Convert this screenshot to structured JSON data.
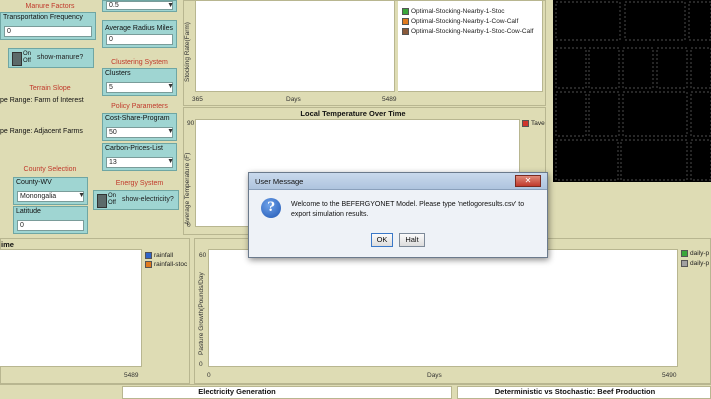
{
  "left_panel": {
    "manure_factors_label": "Manure Factors",
    "transport_label": "Transportation Frequency",
    "transport_value": "0",
    "show_manure_label": "show-manure?",
    "on": "On",
    "off": "Off",
    "terrain_slope_label": "Terrain Slope",
    "slope_farm": "pe Range: Farm of Interest",
    "slope_adjacent": "pe Range: Adjacent Farms",
    "county_selection_label": "County Selection",
    "county_wv_label": "County-WV",
    "county_wv_value": "Monongalia",
    "latitude_label": "Latitude",
    "latitude_value": "0"
  },
  "mid_panel": {
    "top_value": "0.5",
    "avg_radius_label": "Average Radius Miles",
    "avg_radius_value": "0",
    "clustering_label": "Clustering System",
    "clusters_label": "Clusters",
    "clusters_value": "5",
    "policy_label": "Policy Parameters",
    "cost_share_label": "Cost-Share-Program",
    "cost_share_value": "50",
    "carbon_label": "Carbon-Prices-List",
    "carbon_value": "13",
    "energy_label": "Energy System",
    "show_electricity_label": "show-electricity?"
  },
  "stocking_plot": {
    "ylabel": "Stocking Rate(Farm)",
    "x_min": "365",
    "x_mid": "Days",
    "x_max": "5489",
    "legend": [
      {
        "label": "Optimal-Stocking-Nearby-1-Stoc",
        "color": "#3aa63a"
      },
      {
        "label": "Optimal-Stocking-Nearby-1-Cow-Calf",
        "color": "#e07a1e"
      },
      {
        "label": "Optimal-Stocking-Nearby-1-Stoc-Cow-Calf",
        "color": "#8a5a3a"
      }
    ]
  },
  "temp_plot": {
    "title": "Local Temperature Over Time",
    "ylabel": "Average Temperature (F)",
    "y_top": "90",
    "y_bottom": "0",
    "legend_label": "Tave",
    "legend_color": "#d0342c"
  },
  "rain_plot": {
    "title_fragment": "ime",
    "x_max": "5489",
    "legend": [
      {
        "label": "rainfall",
        "color": "#2f64c8"
      },
      {
        "label": "rainfall-stoc",
        "color": "#e07a1e"
      }
    ]
  },
  "pasture_plot": {
    "ylabel": "Pasture Growth(Pounds/Day",
    "y_top": "60",
    "y_bottom": "0",
    "x_min": "0",
    "x_mid": "Days",
    "x_max": "5490",
    "legend": [
      {
        "label": "daily-p",
        "color": "#3aa63a"
      },
      {
        "label": "daily-p",
        "color": "#a0a0a0"
      }
    ]
  },
  "bottom": {
    "electricity_title": "Electricity Generation",
    "beef_title": "Deterministic vs Stochastic: Beef Production"
  },
  "dialog": {
    "title": "User Message",
    "close_glyph": "✕",
    "message": "Welcome to the BEFERGYONET Model. Please type 'netlogoresults.csv' to export simulation results.",
    "ok_label": "OK",
    "halt_label": "Halt"
  },
  "colors": {
    "background": "#dedcb4",
    "widget": "#9fd5d2",
    "view_bg": "#000000"
  }
}
